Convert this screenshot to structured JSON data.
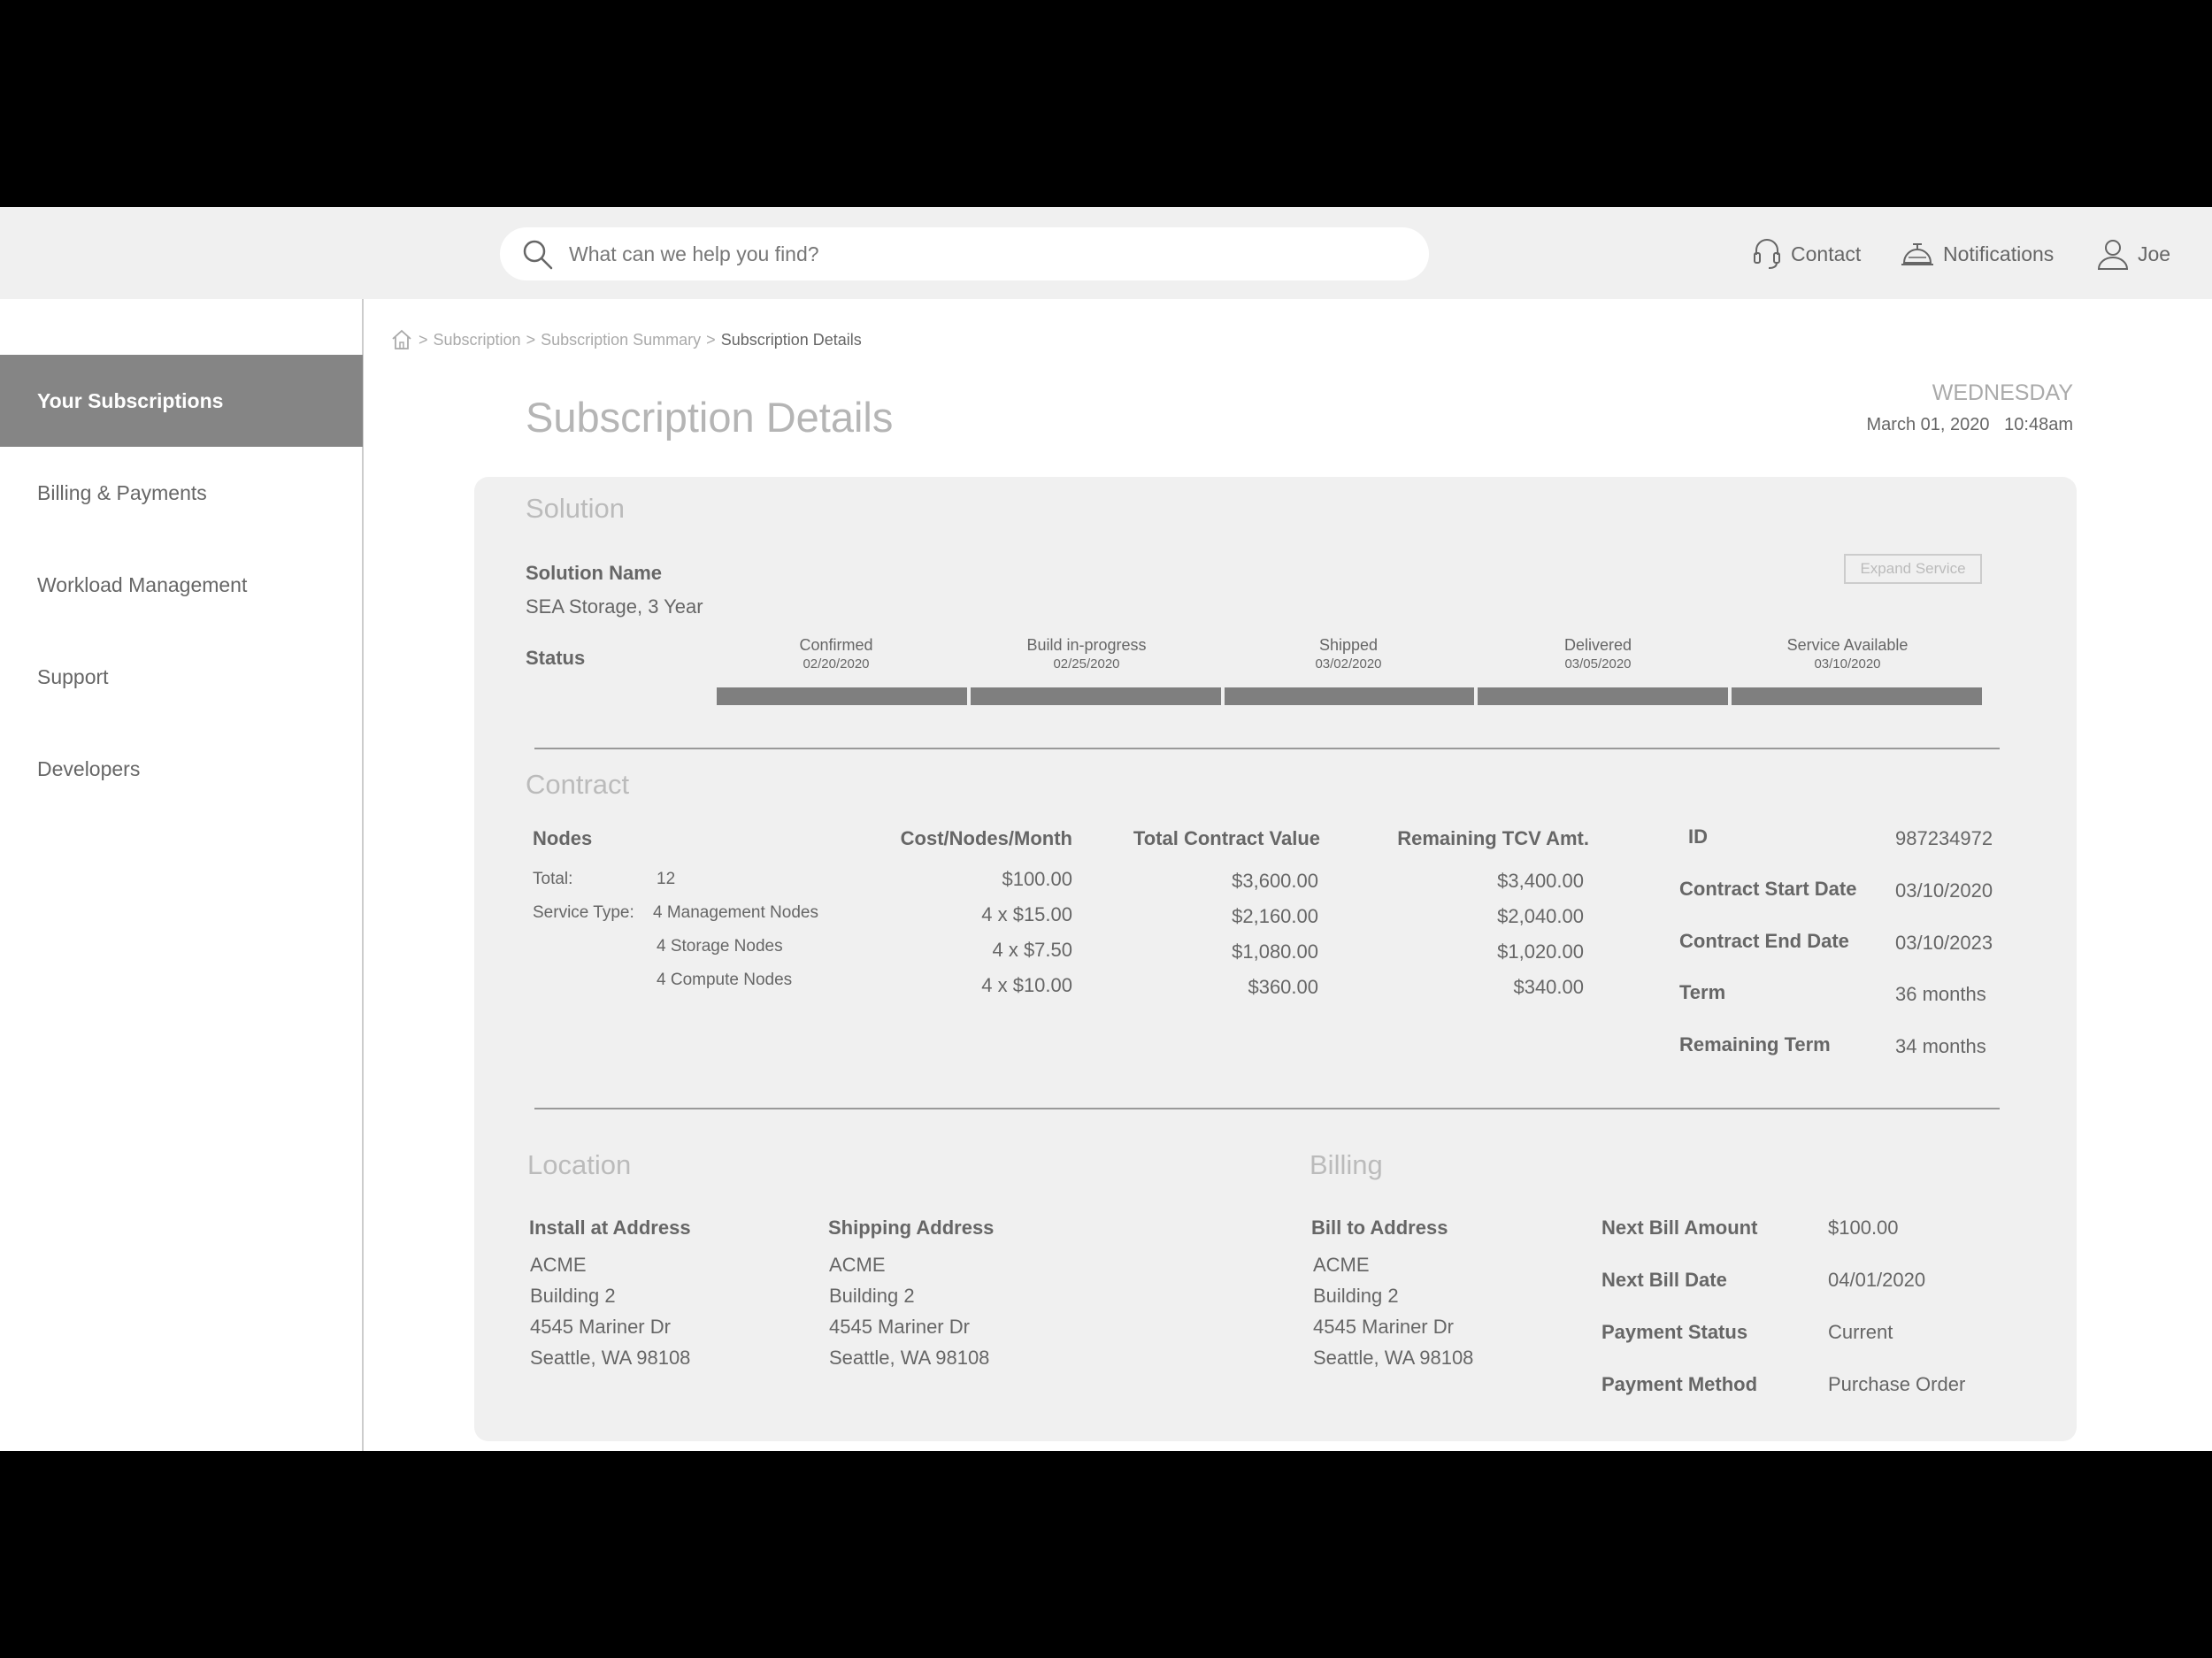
{
  "search": {
    "placeholder": "What can we help you find?"
  },
  "header": {
    "contact_label": "Contact",
    "notifications_label": "Notifications",
    "user_label": "Joe"
  },
  "sidebar": {
    "items": [
      {
        "label": "Your Subscriptions",
        "active": true
      },
      {
        "label": "Billing & Payments",
        "active": false
      },
      {
        "label": "Workload Management",
        "active": false
      },
      {
        "label": "Support",
        "active": false
      },
      {
        "label": "Developers",
        "active": false
      }
    ]
  },
  "breadcrumb": {
    "items": [
      "Subscription",
      "Subscription Summary"
    ],
    "current": "Subscription Details",
    "separator": ">"
  },
  "page": {
    "title": "Subscription Details",
    "weekday": "WEDNESDAY",
    "date": "March 01, 2020",
    "time": "10:48am"
  },
  "solution": {
    "section_title": "Solution",
    "name_label": "Solution Name",
    "name_value": "SEA Storage, 3 Year",
    "expand_button": "Expand Service",
    "status_label": "Status",
    "stages": [
      {
        "label": "Confirmed",
        "date": "02/20/2020"
      },
      {
        "label": "Build in-progress",
        "date": "02/25/2020"
      },
      {
        "label": "Shipped",
        "date": "03/02/2020"
      },
      {
        "label": "Delivered",
        "date": "03/05/2020"
      },
      {
        "label": "Service Available",
        "date": "03/10/2020"
      }
    ]
  },
  "contract": {
    "section_title": "Contract",
    "headers": {
      "nodes": "Nodes",
      "cost": "Cost/Nodes/Month",
      "tcv": "Total Contract Value",
      "remaining": "Remaining TCV Amt."
    },
    "total_label": "Total:",
    "total_value": "12",
    "service_type_label": "Service Type:",
    "rows": [
      {
        "nodes": "",
        "cost": "$100.00",
        "tcv": "$3,600.00",
        "remaining": "$3,400.00"
      },
      {
        "nodes": "4  Management Nodes",
        "cost": "4 x $15.00",
        "tcv": "$2,160.00",
        "remaining": "$2,040.00"
      },
      {
        "nodes": "4  Storage Nodes",
        "cost": "4 x $7.50",
        "tcv": "$1,080.00",
        "remaining": "$1,020.00"
      },
      {
        "nodes": "4  Compute Nodes",
        "cost": "4 x $10.00",
        "tcv": "$360.00",
        "remaining": "$340.00"
      }
    ],
    "details": [
      {
        "label": "ID",
        "value": "987234972"
      },
      {
        "label": "Contract Start Date",
        "value": "03/10/2020"
      },
      {
        "label": "Contract End Date",
        "value": "03/10/2023"
      },
      {
        "label": "Term",
        "value": "36 months"
      },
      {
        "label": "Remaining Term",
        "value": "34 months"
      }
    ]
  },
  "location": {
    "section_title": "Location",
    "install_label": "Install at Address",
    "install_lines": [
      "ACME",
      "Building 2",
      "4545 Mariner Dr",
      "Seattle, WA 98108"
    ],
    "shipping_label": "Shipping Address",
    "shipping_lines": [
      "ACME",
      "Building 2",
      "4545 Mariner Dr",
      "Seattle, WA 98108"
    ]
  },
  "billing": {
    "section_title": "Billing",
    "bill_to_label": "Bill to Address",
    "bill_to_lines": [
      "ACME",
      "Building 2",
      "4545 Mariner Dr",
      "Seattle, WA 98108"
    ],
    "details": [
      {
        "label": "Next Bill Amount",
        "value": "$100.00"
      },
      {
        "label": "Next Bill Date",
        "value": "04/01/2020"
      },
      {
        "label": "Payment Status",
        "value": "Current"
      },
      {
        "label": "Payment Method",
        "value": "Purchase Order"
      }
    ]
  }
}
